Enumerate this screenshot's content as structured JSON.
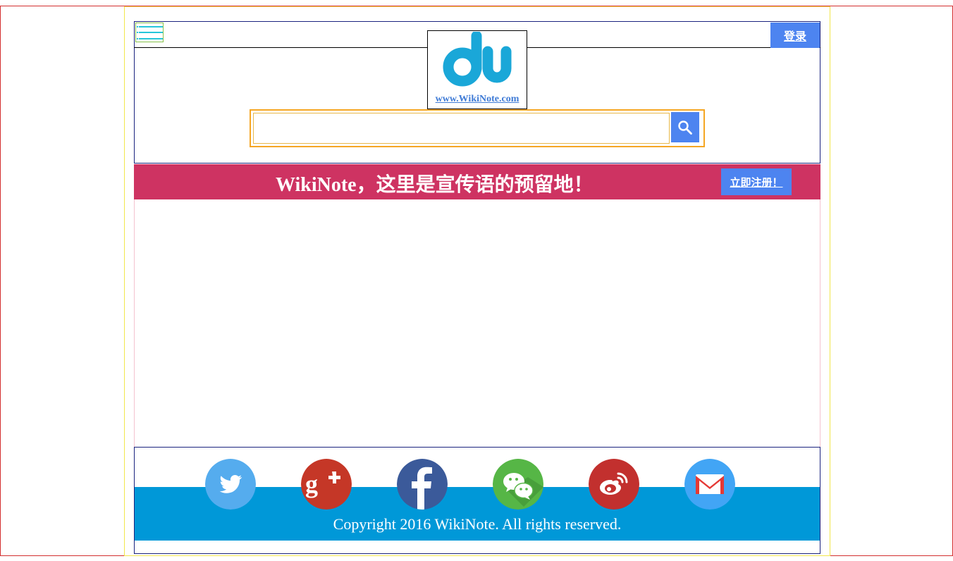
{
  "header": {
    "login_label": "登录",
    "logo_link_text": "www.WikiNote.com",
    "search_placeholder": ""
  },
  "promo": {
    "slogan": "WikiNote，这里是宣传语的预留地！",
    "register_label": "立即注册！"
  },
  "footer": {
    "social_icons": [
      "twitter-icon",
      "google-plus-icon",
      "facebook-icon",
      "wechat-icon",
      "weibo-icon",
      "gmail-icon"
    ],
    "copyright": "Copyright 2016 WikiNote. All rights reserved."
  },
  "colors": {
    "accent_blue": "#4d84f0",
    "promo_bg": "#ce3362",
    "footer_band": "#0098d8",
    "logo_cyan": "#1aa7d8"
  }
}
